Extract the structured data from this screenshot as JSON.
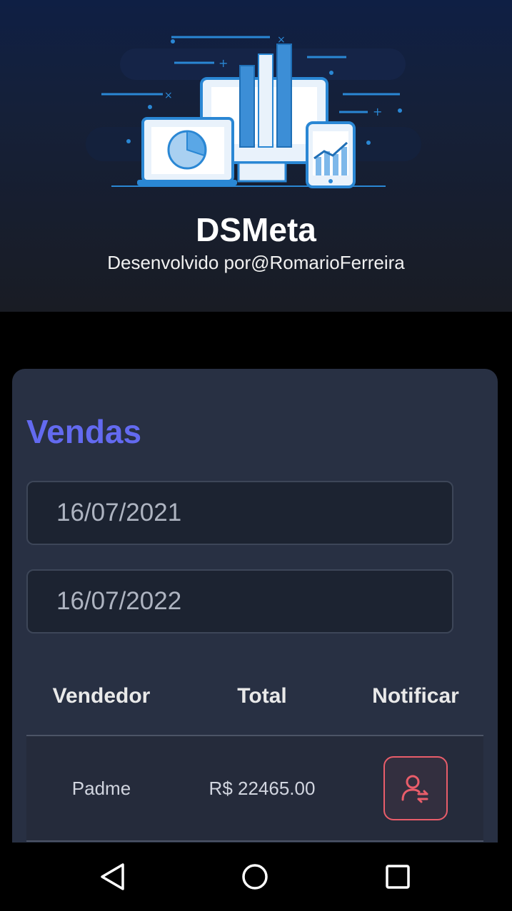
{
  "header": {
    "title": "DSMeta",
    "subtitle": "Desenvolvido por@RomarioFerreira"
  },
  "sales_card": {
    "title": "Vendas",
    "date_min": "16/07/2021",
    "date_max": "16/07/2022",
    "table": {
      "columns": [
        "Vendedor",
        "Total",
        "Notificar"
      ],
      "rows": [
        {
          "seller": "Padme",
          "total": "R$ 22465.00"
        }
      ]
    }
  },
  "colors": {
    "accent": "#636af0",
    "notify_red": "#e95d6a",
    "card_bg": "#283043"
  },
  "icons": {
    "notify": "user-notify-icon",
    "nav": [
      "back-icon",
      "home-icon",
      "recent-apps-icon"
    ]
  }
}
